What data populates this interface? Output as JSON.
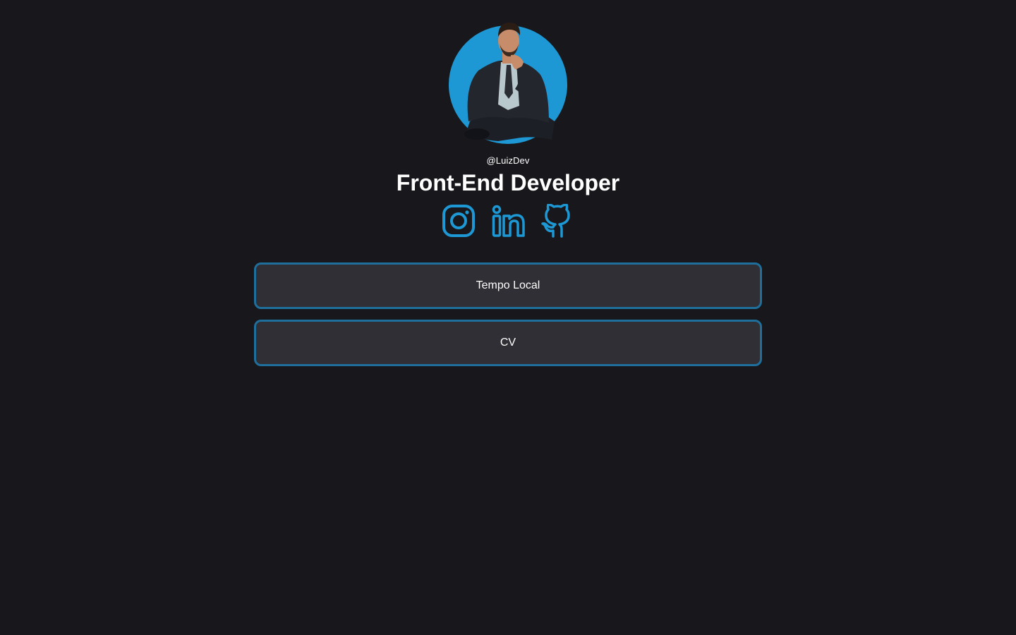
{
  "profile": {
    "handle": "@LuizDev",
    "title": "Front-End Developer",
    "avatar_bg": "#1e98d4"
  },
  "socials": [
    {
      "name": "instagram",
      "icon": "instagram-icon"
    },
    {
      "name": "linkedin",
      "icon": "linkedin-icon"
    },
    {
      "name": "github",
      "icon": "github-icon"
    }
  ],
  "links": [
    {
      "label": "Tempo Local"
    },
    {
      "label": "CV"
    }
  ],
  "colors": {
    "background": "#18181c",
    "accent": "#1e98d4",
    "button_bg": "#2f2f35",
    "button_border": "#1e6f9c"
  }
}
